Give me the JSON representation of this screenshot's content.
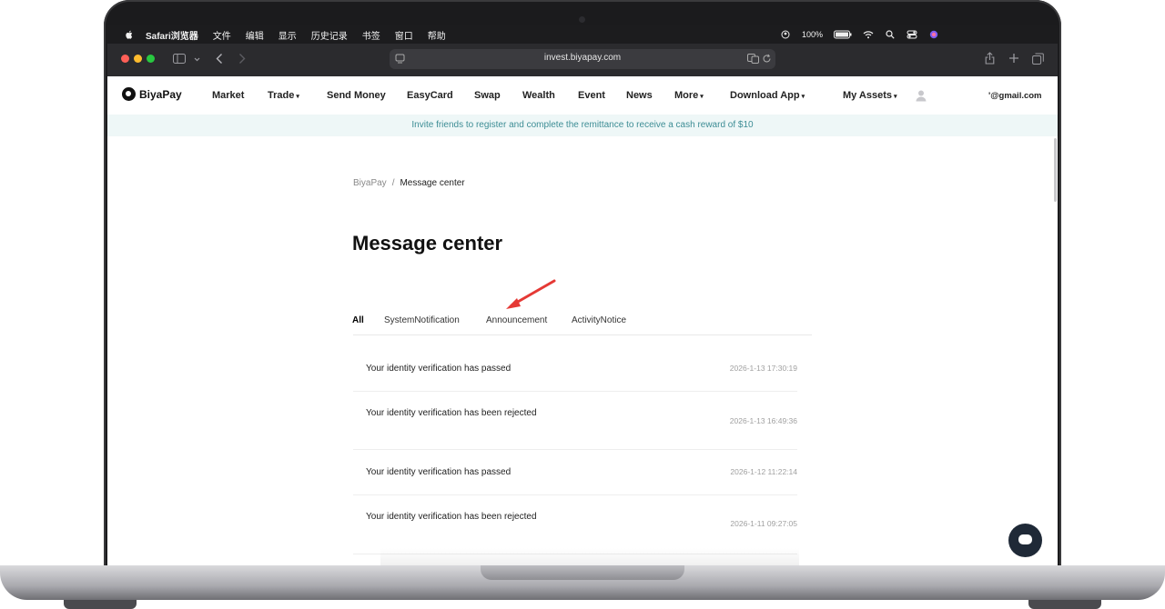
{
  "menubar": {
    "items": [
      "Safari浏览器",
      "文件",
      "编辑",
      "显示",
      "历史记录",
      "书签",
      "窗口",
      "帮助"
    ],
    "battery": "100%"
  },
  "browser": {
    "url": "invest.biyapay.com"
  },
  "site": {
    "logo_text": "BiyaPay",
    "nav": [
      "Market",
      "Trade",
      "Send Money",
      "EasyCard",
      "Swap",
      "Wealth",
      "Event",
      "News",
      "More",
      "Download App",
      "My Assets"
    ],
    "account_email": "'@gmail.com"
  },
  "banner": {
    "text": "Invite friends to register and complete the remittance to receive a cash reward of $10"
  },
  "breadcrumb": {
    "root": "BiyaPay",
    "separator": "/",
    "current": "Message center"
  },
  "page": {
    "title": "Message center",
    "tabs": [
      "All",
      "SystemNotification",
      "Announcement",
      "ActivityNotice"
    ],
    "active_tab": "All"
  },
  "messages": [
    {
      "text": "Your identity verification has passed",
      "time": "2026-1-13 17:30:19"
    },
    {
      "text": "Your identity verification has been rejected",
      "time": "2026-1-13 16:49:36"
    },
    {
      "text": "Your identity verification has passed",
      "time": "2026-1-12 11:22:14"
    },
    {
      "text": "Your identity verification has been rejected",
      "time": "2026-1-11 09:27:05"
    }
  ],
  "colors": {
    "accent_banner_text": "#3d8d95",
    "annotation_arrow": "#e53935",
    "chat_button": "#1f2937"
  }
}
